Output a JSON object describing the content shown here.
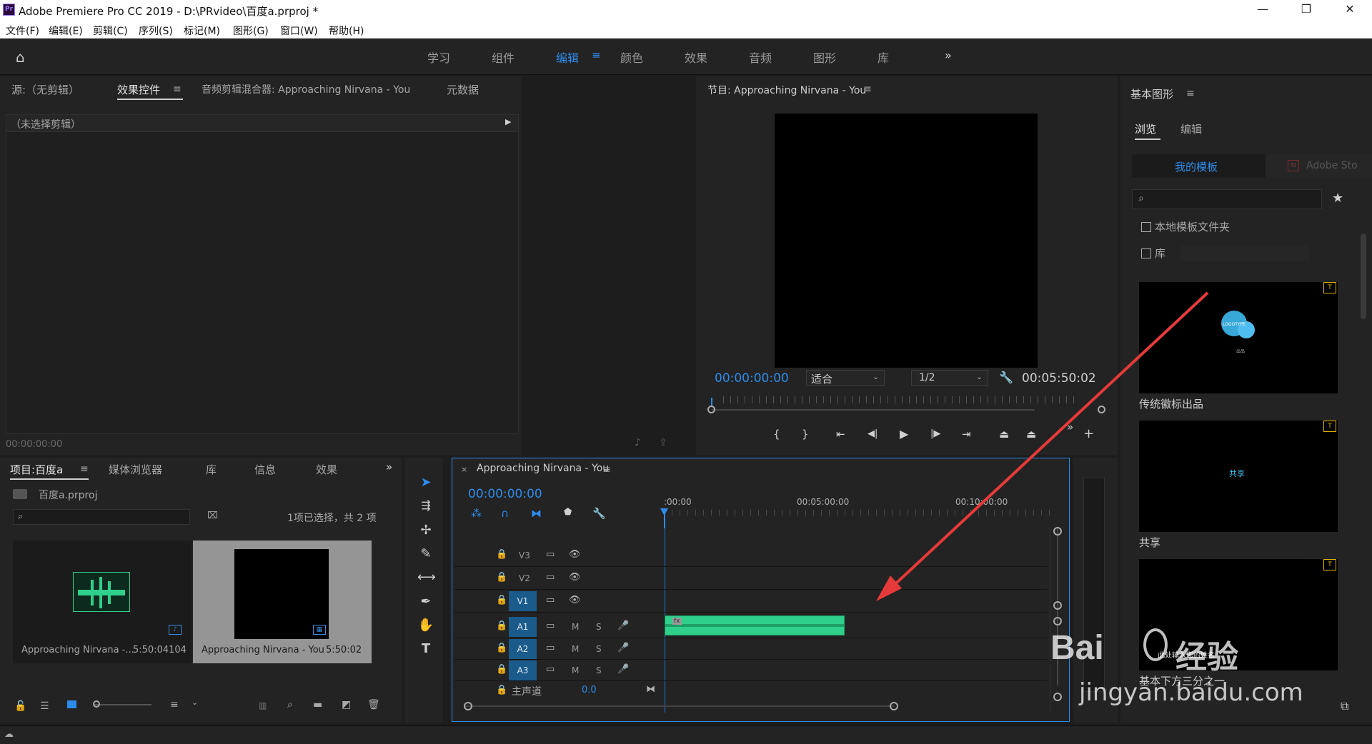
{
  "window": {
    "logo": "Pr",
    "title": "Adobe Premiere Pro CC 2019 - D:\\PRvideo\\百度a.prproj *"
  },
  "menu": [
    "文件(F)",
    "编辑(E)",
    "剪辑(C)",
    "序列(S)",
    "标记(M)",
    "图形(G)",
    "窗口(W)",
    "帮助(H)"
  ],
  "workspaces": [
    "学习",
    "组件",
    "编辑",
    "颜色",
    "效果",
    "音频",
    "图形",
    "库"
  ],
  "active_workspace": "编辑",
  "source_panel": {
    "tabs": [
      "源:（无剪辑）",
      "效果控件",
      "音频剪辑混合器: Approaching Nirvana - You",
      "元数据"
    ],
    "no_clip": "（未选择剪辑）",
    "timecode": "00:00:00:00"
  },
  "program_monitor": {
    "title": "节目: Approaching Nirvana - You",
    "timecode": "00:00:00:00",
    "fit": "适合",
    "resolution": "1/2",
    "duration": "00:05:50:02"
  },
  "essential_graphics": {
    "title": "基本图形",
    "tabs": [
      "浏览",
      "编辑"
    ],
    "my_templates": "我的模板",
    "adobe_stock": "Adobe Sto",
    "local_folder": "本地模板文件夹",
    "library": "库",
    "templates": [
      {
        "name": "传统徽标出品",
        "logo_text": "LOGOTYPE",
        "sub_text": "出品"
      },
      {
        "name": "共享",
        "preview_text": "共享"
      },
      {
        "name": "基本下方三分之一",
        "preview_text": "此处输入您的姓名"
      }
    ]
  },
  "project_panel": {
    "tabs": [
      "项目:百度a",
      "媒体浏览器",
      "库",
      "信息",
      "效果"
    ],
    "file": "百度a.prproj",
    "selection": "1项已选择，共 2 项",
    "items": [
      {
        "name": "Approaching Nirvana -...",
        "duration": "5:50:04104"
      },
      {
        "name": "Approaching Nirvana - You",
        "duration": "5:50:02"
      }
    ]
  },
  "timeline": {
    "title": "Approaching Nirvana - You",
    "close": "×",
    "timecode": "00:00:00:00",
    "ruler": [
      ":00:00",
      "00:05:00:00",
      "00:10:00:00"
    ],
    "video_tracks": [
      "V3",
      "V2",
      "V1"
    ],
    "audio_tracks": [
      "A1",
      "A2",
      "A3"
    ],
    "mute": "M",
    "solo": "S",
    "master": "主声道",
    "master_value": "0.0",
    "clip_fx": "fx"
  },
  "watermark": {
    "text": "经验",
    "url": "jingyan.baidu.com"
  },
  "colors": {
    "accent": "#2d8ceb",
    "audio_clip": "#2fcf8c",
    "arrow": "#e63a3a",
    "target": "#1a5b8b"
  }
}
